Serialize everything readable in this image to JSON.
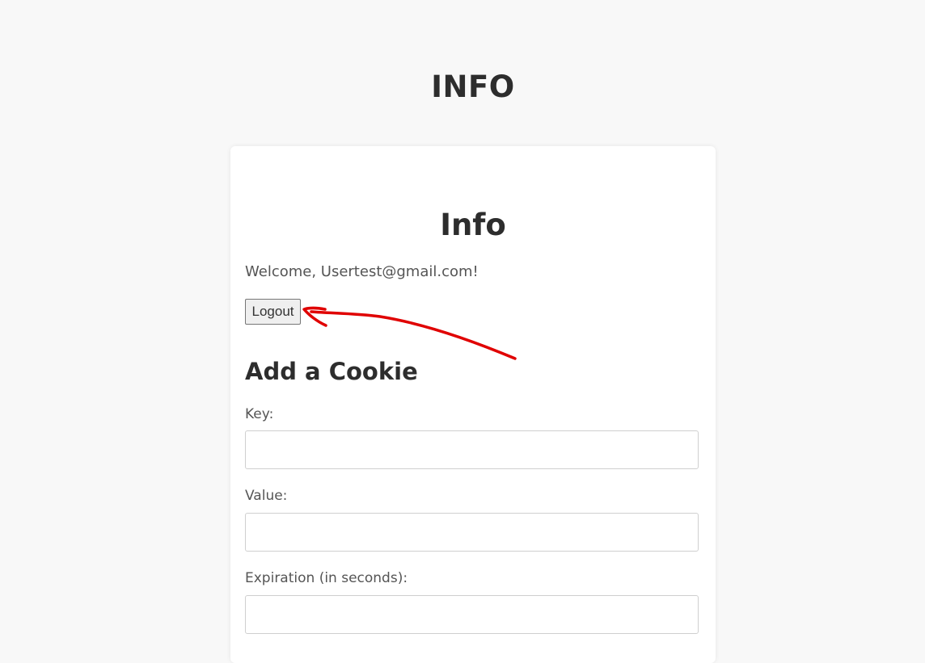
{
  "header": {
    "title": "INFO"
  },
  "card": {
    "title": "Info",
    "welcome": "Welcome, Usertest@gmail.com!",
    "logout_label": "Logout"
  },
  "cookie_form": {
    "title": "Add a Cookie",
    "key_label": "Key:",
    "key_value": "",
    "value_label": "Value:",
    "value_value": "",
    "expiration_label": "Expiration (in seconds):",
    "expiration_value": ""
  },
  "annotation": {
    "arrow_color": "#e00000"
  },
  "colors": {
    "background": "#f8f8f8",
    "card": "#ffffff",
    "heading": "#2d2d2d"
  }
}
